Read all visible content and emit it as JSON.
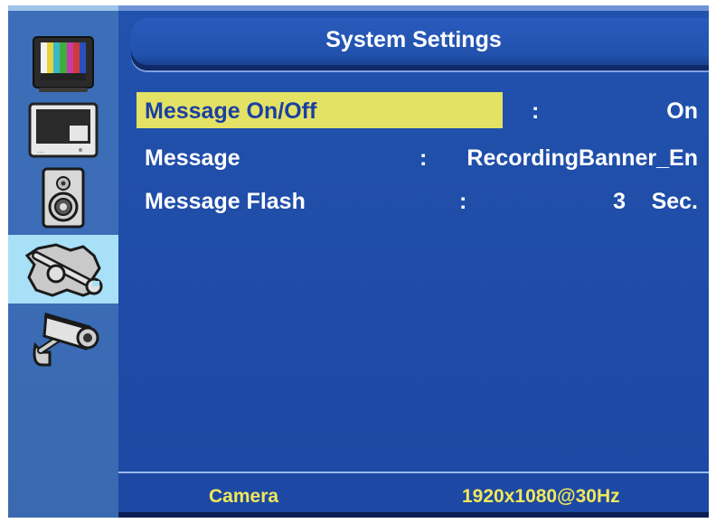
{
  "title": "System Settings",
  "sidebar": {
    "items": [
      {
        "icon": "tv-color-bars-icon",
        "selected": false
      },
      {
        "icon": "monitor-icon",
        "selected": false
      },
      {
        "icon": "speaker-icon",
        "selected": false
      },
      {
        "icon": "tools-icon",
        "selected": true
      },
      {
        "icon": "camera-icon",
        "selected": false
      }
    ]
  },
  "settings": [
    {
      "label": "Message On/Off",
      "colon": ":",
      "value": "On",
      "unit": ""
    },
    {
      "label": "Message",
      "colon": ":",
      "value": "RecordingBanner_En",
      "unit": ""
    },
    {
      "label": "Message Flash",
      "colon": ":",
      "value": "3",
      "unit": "Sec."
    }
  ],
  "footer": {
    "source": "Camera",
    "resolution": "1920x1080@30Hz"
  },
  "colors": {
    "background": "#1f4aa8",
    "highlight": "#e3e264",
    "footer_text": "#f0e85a",
    "selected_item": "#a7e0f7"
  }
}
